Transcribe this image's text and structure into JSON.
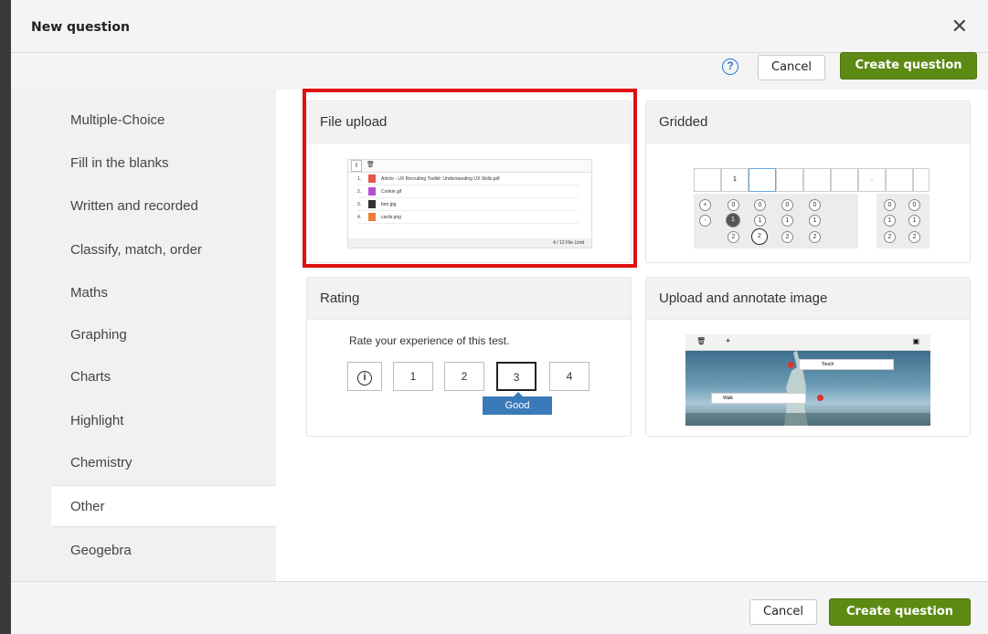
{
  "dialog": {
    "title": "New question",
    "close_icon": "close-icon"
  },
  "toolbar": {
    "help_icon": "?",
    "cancel_label": "Cancel",
    "create_label": "Create question"
  },
  "sidebar": {
    "items": [
      {
        "label": "Multiple-Choice"
      },
      {
        "label": "Fill in the blanks"
      },
      {
        "label": "Written and recorded"
      },
      {
        "label": "Classify, match, order"
      },
      {
        "label": "Maths"
      },
      {
        "label": "Graphing"
      },
      {
        "label": "Charts"
      },
      {
        "label": "Highlight"
      },
      {
        "label": "Chemistry"
      },
      {
        "label": "Other"
      },
      {
        "label": "Geogebra"
      }
    ],
    "active": "Other"
  },
  "cards": {
    "file_upload": {
      "title": "File upload",
      "files": [
        {
          "num": "1.",
          "name": "Article - UX Recruiting Toolkit: Understanding UX Skills.pdf",
          "color": "#e8554e"
        },
        {
          "num": "2.",
          "name": "Cookie.gif",
          "color": "#b44fd0"
        },
        {
          "num": "3.",
          "name": "fam.jpg",
          "color": "#333333"
        },
        {
          "num": "4.",
          "name": "cards.png",
          "color": "#f07b3f"
        }
      ],
      "limit": "4 / 12 File Limit"
    },
    "gridded": {
      "title": "Gridded",
      "top_value": "1",
      "dot": ".",
      "signs": [
        "+",
        "-"
      ],
      "digits_row0": "0",
      "digits_row1": "1",
      "digits_row2": "2"
    },
    "rating": {
      "title": "Rating",
      "prompt": "Rate your experience of this test.",
      "info_icon": "i",
      "options": [
        "1",
        "2",
        "3",
        "4"
      ],
      "selected_label": "Good"
    },
    "annotate": {
      "title": "Upload and annotate image",
      "label_touch": "Touch",
      "label_walk": "Walk"
    }
  },
  "footer": {
    "cancel_label": "Cancel",
    "create_label": "Create question"
  },
  "colors": {
    "accent_green": "#5d8a13",
    "highlight_red": "#e01010",
    "rating_blue": "#3b7ab8"
  }
}
